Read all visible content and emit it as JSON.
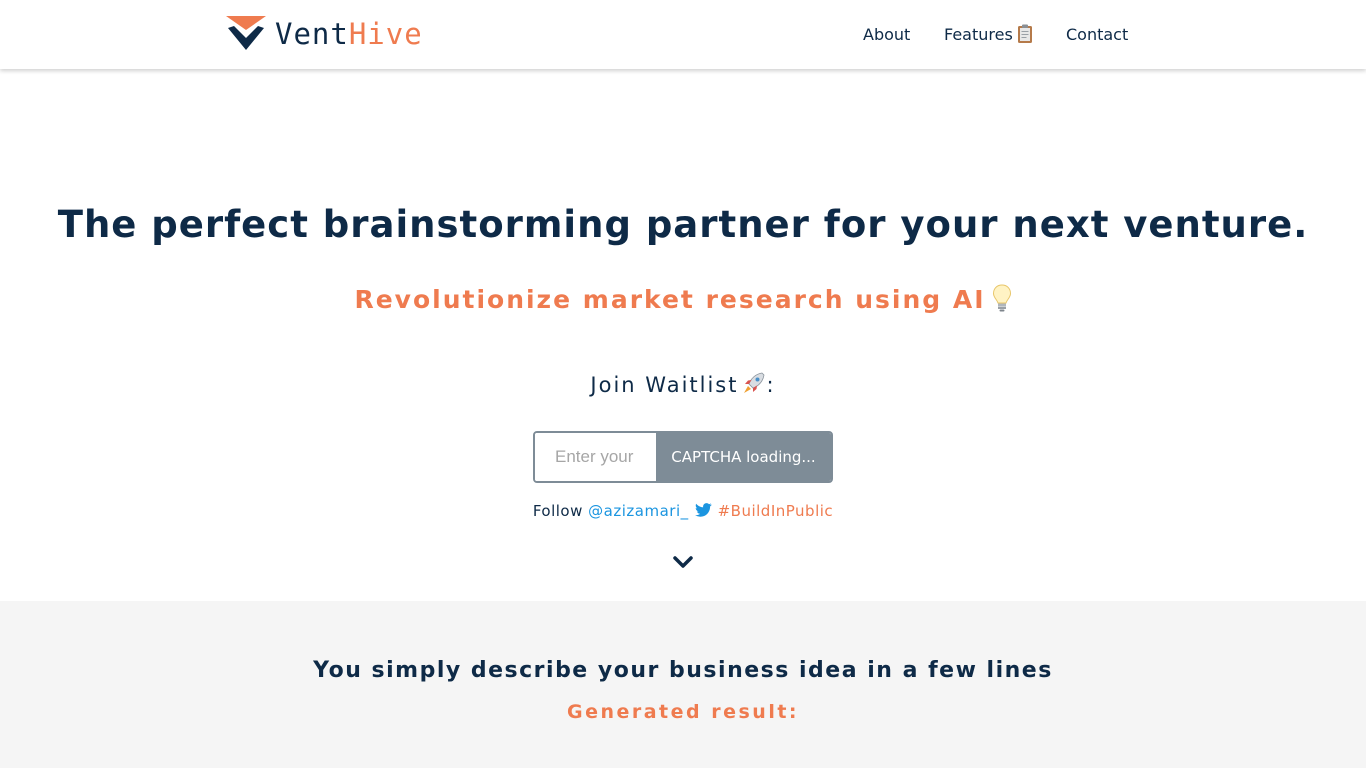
{
  "brand": {
    "name_part1": "Vent",
    "name_part2": "Hive",
    "logo_icon": "chevron-v-logo-icon",
    "color_dark": "#0e2a47",
    "color_accent": "#ef7b4f"
  },
  "nav": {
    "about": "About",
    "features": "Features",
    "features_icon": "clipboard-icon",
    "contact": "Contact"
  },
  "hero": {
    "title": "The perfect brainstorming partner for your next venture.",
    "subtitle": "Revolutionize market research using AI",
    "subtitle_icon": "lightbulb-icon",
    "waitlist_label": "Join Waitlist",
    "waitlist_icon": "rocket-icon",
    "waitlist_suffix": ":",
    "email_placeholder": "Enter your",
    "email_value": "",
    "captcha_button": "CAPTCHA loading...",
    "follow_prefix": "Follow",
    "twitter_handle": "@azizamari_",
    "twitter_icon": "twitter-bird-icon",
    "hashtag": "#BuildInPublic",
    "scroll_icon": "chevron-down-icon"
  },
  "features": {
    "heading": "You simply describe your business idea in a few lines",
    "subheading": "Generated result:"
  },
  "colors": {
    "button_gray": "#7e8c97",
    "twitter_blue": "#1b95e0",
    "section_bg": "#f5f5f5"
  }
}
